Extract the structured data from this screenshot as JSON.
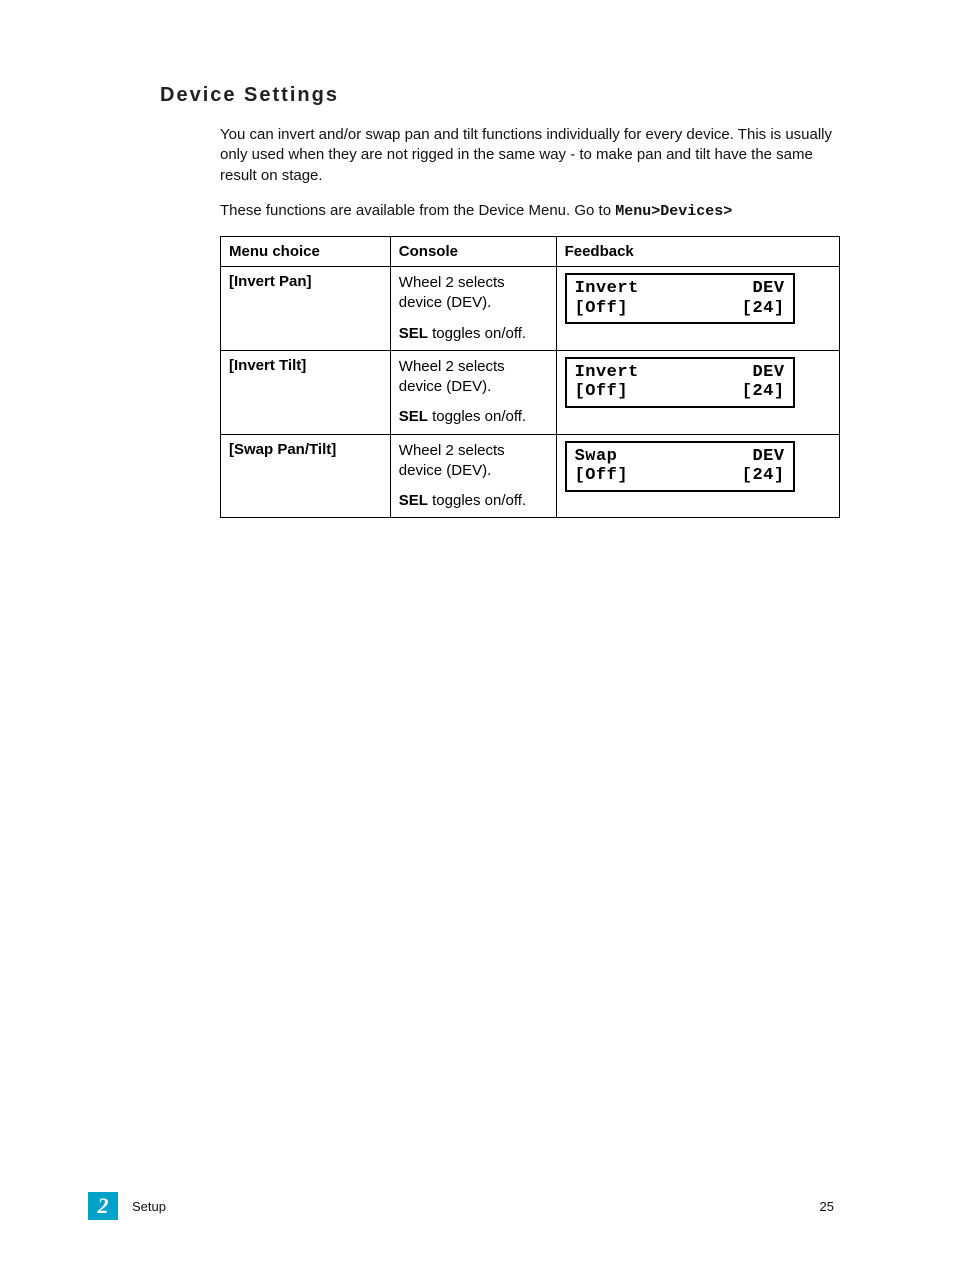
{
  "heading": "Device Settings",
  "intro": "You can invert and/or swap pan and tilt functions individually for every device. This is usually only used when they are not rigged in the same way - to make pan and tilt have the same result on stage.",
  "nav_sentence_prefix": "These functions are available from the Device Menu. Go to ",
  "nav_path": "Menu>Devices>",
  "table": {
    "headers": {
      "menu": "Menu choice",
      "console": "Console",
      "feedback": "Feedback"
    },
    "rows": [
      {
        "menu": "[Invert Pan]",
        "console_line1": "Wheel 2 selects device (DEV).",
        "console_sel": "SEL",
        "console_tail": " toggles on/off.",
        "lcd": {
          "l1a": "Invert",
          "l1b": "DEV",
          "l2a": "[Off]",
          "l2b": "[24]"
        }
      },
      {
        "menu": "[Invert Tilt]",
        "console_line1": "Wheel 2 selects device (DEV).",
        "console_sel": "SEL",
        "console_tail": " toggles on/off.",
        "lcd": {
          "l1a": "Invert",
          "l1b": "DEV",
          "l2a": "[Off]",
          "l2b": "[24]"
        }
      },
      {
        "menu": "[Swap Pan/Tilt]",
        "console_line1": "Wheel 2 selects device (DEV).",
        "console_sel": "SEL",
        "console_tail": " toggles on/off.",
        "lcd": {
          "l1a": "Swap",
          "l1b": "DEV",
          "l2a": "[Off]",
          "l2b": "[24]"
        }
      }
    ]
  },
  "footer": {
    "chapter": "2",
    "section": "Setup",
    "page": "25"
  }
}
